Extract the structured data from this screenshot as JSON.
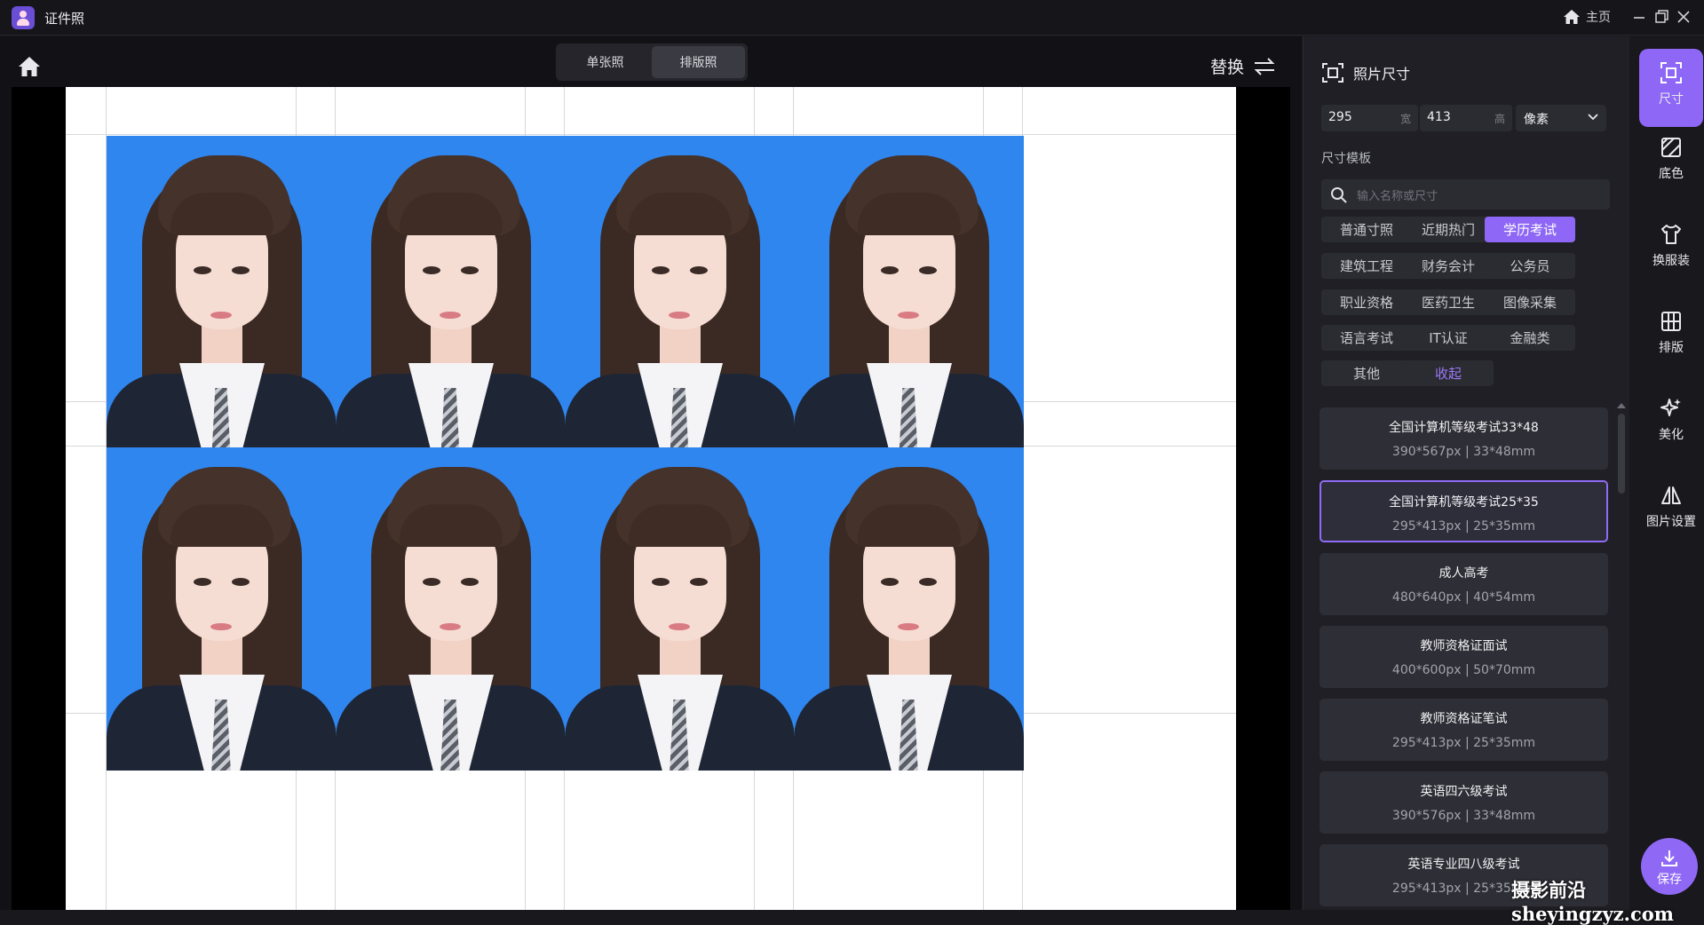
{
  "titlebar": {
    "app_title": "证件照",
    "home_label": "主页"
  },
  "workspace": {
    "tabs": [
      {
        "label": "单张照",
        "active": false
      },
      {
        "label": "排版照",
        "active": true
      }
    ],
    "replace_label": "替换",
    "layout": {
      "rows": 2,
      "columns": 4,
      "photo_background": "#2f86ef"
    }
  },
  "panel": {
    "title": "照片尺寸",
    "width_value": "295",
    "width_unit": "宽",
    "height_value": "413",
    "height_unit": "高",
    "unit_select": "像素",
    "templates_label": "尺寸模板",
    "search_placeholder": "输入名称或尺寸",
    "chips": [
      "普通寸照",
      "近期热门",
      "学历考试",
      "建筑工程",
      "财务会计",
      "公务员",
      "职业资格",
      "医药卫生",
      "图像采集",
      "语言考试",
      "IT认证",
      "金融类",
      "其他",
      "收起"
    ],
    "active_chip": "学历考试",
    "cards": [
      {
        "name": "全国计算机等级考试33*48",
        "spec": "390*567px | 33*48mm"
      },
      {
        "name": "全国计算机等级考试25*35",
        "spec": "295*413px | 25*35mm"
      },
      {
        "name": "成人高考",
        "spec": "480*640px | 40*54mm"
      },
      {
        "name": "教师资格证面试",
        "spec": "400*600px | 50*70mm"
      },
      {
        "name": "教师资格证笔试",
        "spec": "295*413px | 25*35mm"
      },
      {
        "name": "英语四六级考试",
        "spec": "390*576px | 33*48mm"
      },
      {
        "name": "英语专业四八级考试",
        "spec": "295*413px | 25*35mm"
      }
    ],
    "selected_card": 1
  },
  "tools": [
    {
      "label": "尺寸",
      "icon": "crop-frame-icon",
      "active": true
    },
    {
      "label": "底色",
      "icon": "background-color-icon",
      "active": false
    },
    {
      "label": "换服装",
      "icon": "shirt-icon",
      "active": false
    },
    {
      "label": "排版",
      "icon": "grid-icon",
      "active": false
    },
    {
      "label": "美化",
      "icon": "sparkle-icon",
      "active": false
    },
    {
      "label": "图片设置",
      "icon": "mirror-icon",
      "active": false
    }
  ],
  "save_label": "保存",
  "watermark": "摄影前沿 sheyingzyz.com",
  "colors": {
    "accent": "#8e67f6",
    "photo_blue": "#2f86ef"
  }
}
